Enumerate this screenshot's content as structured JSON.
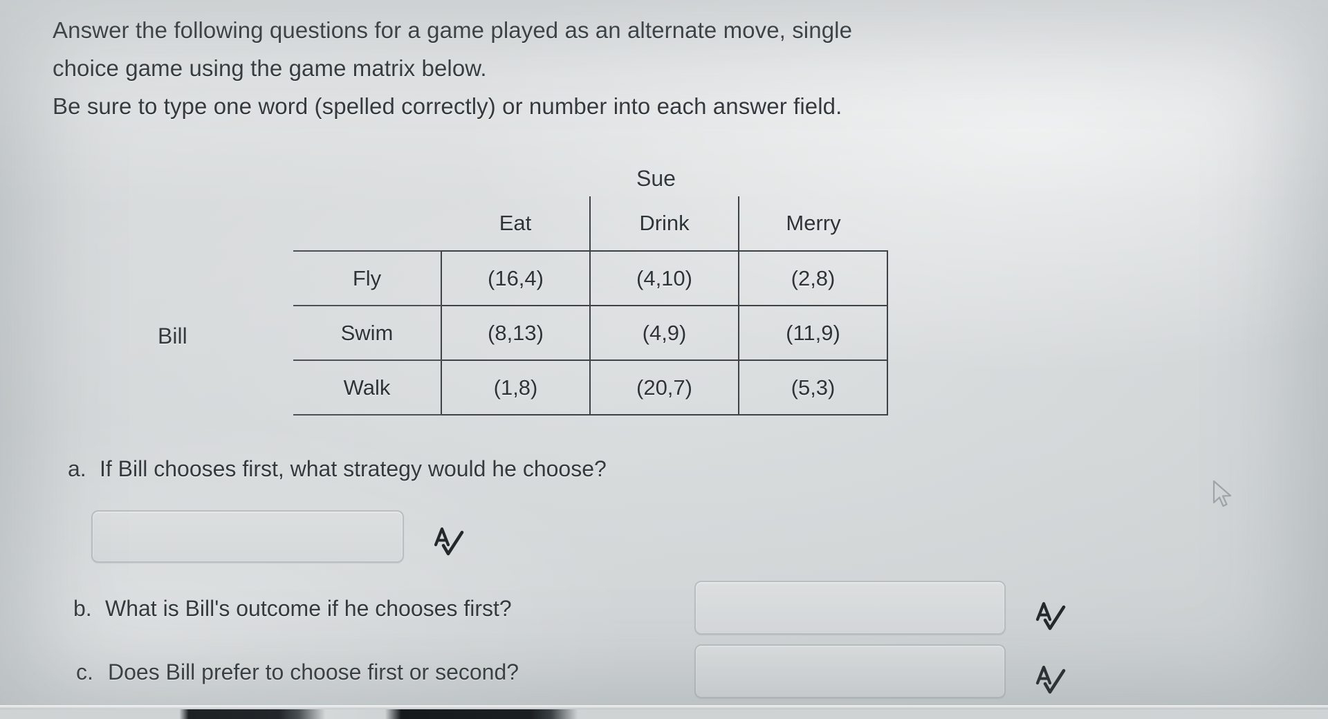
{
  "page": {
    "intro_line1": "Answer the following questions for a game played as an alternate move, single",
    "intro_line2": "choice game using the game matrix below.",
    "intro_line3": "Be sure to type one word (spelled correctly) or number into each answer field."
  },
  "matrix": {
    "column_player_label": "Sue",
    "row_player_label": "Bill",
    "column_headers": [
      "Eat",
      "Drink",
      "Merry"
    ],
    "row_headers": [
      "Fly",
      "Swim",
      "Walk"
    ],
    "payoffs": [
      [
        "(16,4)",
        "(4,10)",
        "(2,8)"
      ],
      [
        "(8,13)",
        "(4,9)",
        "(11,9)"
      ],
      [
        "(1,8)",
        "(20,7)",
        "(5,3)"
      ]
    ]
  },
  "questions": [
    {
      "marker": "a.",
      "text": "If Bill chooses first, what strategy would he choose?",
      "answer_value": "",
      "answer_placeholder": ""
    },
    {
      "marker": "b.",
      "text": "What is Bill's outcome if he chooses first?",
      "answer_value": "",
      "answer_placeholder": ""
    },
    {
      "marker": "c.",
      "text": "Does Bill prefer to choose first or second?",
      "answer_value": "",
      "answer_placeholder": ""
    }
  ],
  "icons": {
    "spellcheck": "spellcheck-icon",
    "cursor": "mouse-pointer-icon"
  },
  "colors": {
    "background": "#d9dcdc",
    "text": "#33393c",
    "matrix_border": "#3c4245",
    "input_border": "#b9bec0"
  }
}
